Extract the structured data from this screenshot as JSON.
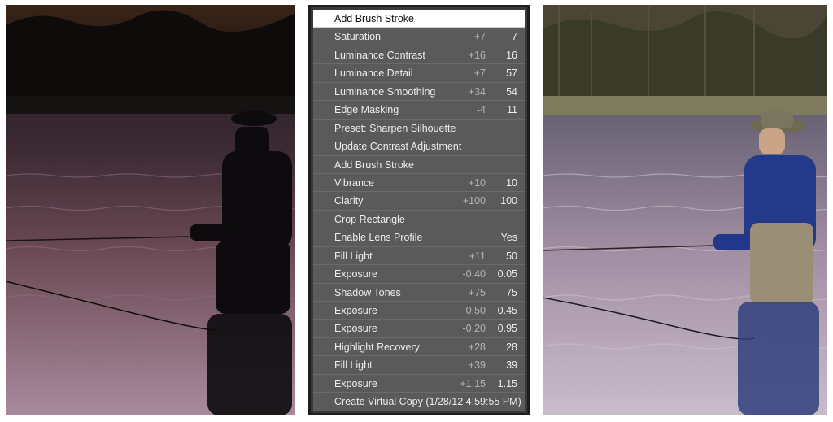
{
  "history": {
    "steps": [
      {
        "name": "Add Brush Stroke",
        "delta": "",
        "value": "",
        "selected": true
      },
      {
        "name": "Saturation",
        "delta": "+7",
        "value": "7"
      },
      {
        "name": "Luminance Contrast",
        "delta": "+16",
        "value": "16"
      },
      {
        "name": "Luminance Detail",
        "delta": "+7",
        "value": "57"
      },
      {
        "name": "Luminance Smoothing",
        "delta": "+34",
        "value": "54"
      },
      {
        "name": "Edge Masking",
        "delta": "-4",
        "value": "11"
      },
      {
        "name": "Preset: Sharpen Silhouette",
        "delta": "",
        "value": ""
      },
      {
        "name": "Update Contrast Adjustment",
        "delta": "",
        "value": ""
      },
      {
        "name": "Add Brush Stroke",
        "delta": "",
        "value": ""
      },
      {
        "name": "Vibrance",
        "delta": "+10",
        "value": "10"
      },
      {
        "name": "Clarity",
        "delta": "+100",
        "value": "100"
      },
      {
        "name": "Crop Rectangle",
        "delta": "",
        "value": ""
      },
      {
        "name": "Enable Lens Profile",
        "delta": "",
        "value": "Yes"
      },
      {
        "name": "Fill Light",
        "delta": "+11",
        "value": "50"
      },
      {
        "name": "Exposure",
        "delta": "-0.40",
        "value": "0.05"
      },
      {
        "name": "Shadow Tones",
        "delta": "+75",
        "value": "75"
      },
      {
        "name": "Exposure",
        "delta": "-0.50",
        "value": "0.45"
      },
      {
        "name": "Exposure",
        "delta": "-0.20",
        "value": "0.95"
      },
      {
        "name": "Highlight Recovery",
        "delta": "+28",
        "value": "28"
      },
      {
        "name": "Fill Light",
        "delta": "+39",
        "value": "39"
      },
      {
        "name": "Exposure",
        "delta": "+1.15",
        "value": "1.15"
      },
      {
        "name": "Create Virtual Copy (1/28/12 4:59:55 PM)",
        "delta": "",
        "value": ""
      }
    ]
  },
  "colors": {
    "panel_bg": "#5a5a5a",
    "panel_border": "#1e1e1e",
    "selected_bg": "#ffffff",
    "text": "#ececec",
    "delta_text": "#b4b4b4"
  }
}
